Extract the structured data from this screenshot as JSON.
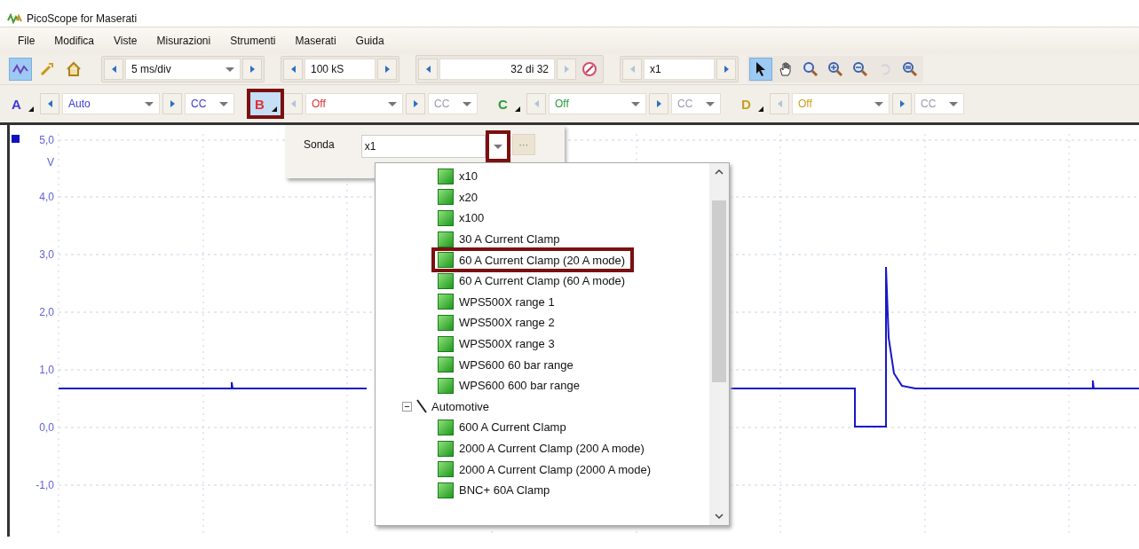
{
  "window": {
    "title": "PicoScope for Maserati"
  },
  "menu": [
    "File",
    "Modifica",
    "Viste",
    "Misurazioni",
    "Strumenti",
    "Maserati",
    "Guida"
  ],
  "toolbar": {
    "mode_selected": true,
    "timebase": "5 ms/div",
    "samples": "100 kS",
    "buffer": "32 di 32",
    "zoom": "x1",
    "tools": [
      {
        "kind": "pointer",
        "selected": true
      },
      {
        "kind": "hand",
        "selected": false
      },
      {
        "kind": "zoom",
        "selected": false
      },
      {
        "kind": "zoom-in",
        "selected": false
      },
      {
        "kind": "zoom-out",
        "selected": false
      },
      {
        "kind": "undo",
        "selected": false,
        "disabled": true
      },
      {
        "kind": "zoom-fit",
        "selected": false
      }
    ]
  },
  "channels": [
    {
      "label": "A",
      "color": "#3a3ad8",
      "range": "Auto",
      "coupling": "CC",
      "enabled": true,
      "highlighted": false,
      "open": false
    },
    {
      "label": "B",
      "color": "#e03030",
      "range": "Off",
      "coupling": "CC",
      "enabled": false,
      "highlighted": true,
      "open": true
    },
    {
      "label": "C",
      "color": "#2a9a3a",
      "range": "Off",
      "coupling": "CC",
      "enabled": false,
      "highlighted": false,
      "open": false
    },
    {
      "label": "D",
      "color": "#c8a020",
      "range": "Off",
      "coupling": "CC",
      "enabled": false,
      "highlighted": false,
      "open": false
    }
  ],
  "plot": {
    "unit": "V",
    "y_labels": [
      "5,0",
      "4,0",
      "3,0",
      "2,0",
      "1,0",
      "0,0",
      "-1,0"
    ]
  },
  "probe_popup": {
    "label": "Sonda",
    "value": "x1",
    "browse": "···",
    "arrow_highlighted": true,
    "items": [
      {
        "label": "x10",
        "highlighted": false
      },
      {
        "label": "x20",
        "highlighted": false
      },
      {
        "label": "x100",
        "highlighted": false
      },
      {
        "label": "30 A Current Clamp",
        "highlighted": false
      },
      {
        "label": "60 A Current Clamp (20 A mode)",
        "highlighted": true
      },
      {
        "label": "60 A Current Clamp (60 A mode)",
        "highlighted": false
      },
      {
        "label": "WPS500X range 1",
        "highlighted": false
      },
      {
        "label": "WPS500X range 2",
        "highlighted": false
      },
      {
        "label": "WPS500X range 3",
        "highlighted": false
      },
      {
        "label": "WPS600 60 bar range",
        "highlighted": false
      },
      {
        "label": "WPS600 600 bar range",
        "highlighted": false
      }
    ],
    "groups": [
      {
        "label": "Automotive",
        "expanded": true,
        "children": [
          {
            "label": "600 A Current Clamp",
            "highlighted": false
          },
          {
            "label": "2000 A Current Clamp (200 A mode)",
            "highlighted": false
          },
          {
            "label": "2000 A Current Clamp (2000 A mode)",
            "highlighted": false
          },
          {
            "label": "BNC+ 60A Clamp",
            "highlighted": false
          }
        ]
      }
    ]
  }
}
